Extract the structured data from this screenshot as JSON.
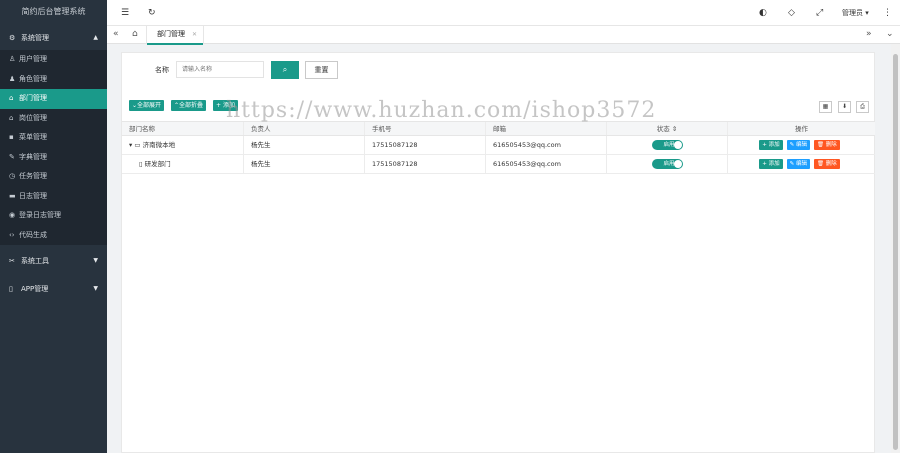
{
  "app": {
    "title": "简约后台管理系统"
  },
  "sidebar": {
    "group1": {
      "label": "系统管理"
    },
    "items": [
      {
        "label": "用户管理",
        "icon": "user-icon"
      },
      {
        "label": "角色管理",
        "icon": "role-icon"
      },
      {
        "label": "部门管理",
        "icon": "home-icon",
        "active": true
      },
      {
        "label": "岗位管理",
        "icon": "post-icon"
      },
      {
        "label": "菜单管理",
        "icon": "menu-icon"
      },
      {
        "label": "字典管理",
        "icon": "dict-icon"
      },
      {
        "label": "任务管理",
        "icon": "task-icon"
      },
      {
        "label": "日志管理",
        "icon": "log-icon"
      },
      {
        "label": "登录日志管理",
        "icon": "location-icon"
      },
      {
        "label": "代码生成",
        "icon": "code-icon"
      }
    ],
    "group2": {
      "label": "系统工具"
    },
    "group3": {
      "label": "APP管理"
    }
  },
  "topbar": {
    "user": "管理员"
  },
  "tabs": {
    "active": "部门管理"
  },
  "search": {
    "label": "名称",
    "placeholder": "请输入名称",
    "reset": "重置"
  },
  "toolbar": {
    "expand": "全部展开",
    "collapse": "全部折叠",
    "add": "添加"
  },
  "table": {
    "headers": {
      "name": "部门名称",
      "leader": "负责人",
      "phone": "手机号",
      "email": "邮箱",
      "status": "状态",
      "ops": "操作"
    },
    "rows": [
      {
        "name": "济南微本地",
        "leader": "杨先生",
        "phone": "17515087128",
        "email": "616505453@qq.com",
        "status": "启用"
      },
      {
        "name": "研发部门",
        "leader": "杨先生",
        "phone": "17515087128",
        "email": "616505453@qq.com",
        "status": "启用"
      }
    ],
    "op_add": "添加",
    "op_edit": "编辑",
    "op_del": "删除"
  },
  "watermark": "https://www.huzhan.com/ishop3572",
  "colors": {
    "accent": "#1a9a8a",
    "edit": "#1e9fff",
    "delete": "#ff5722",
    "sidebar": "#28333e"
  }
}
